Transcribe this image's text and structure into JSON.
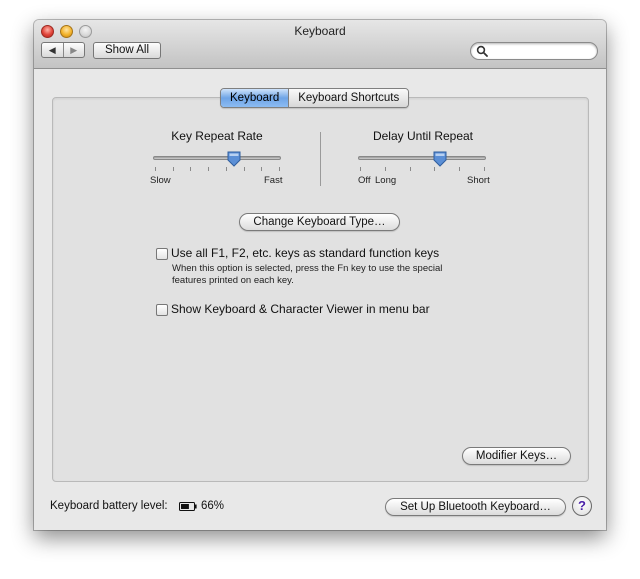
{
  "window": {
    "title": "Keyboard",
    "toolbar": {
      "back_glyph": "◀",
      "forward_glyph": "▶",
      "show_all_label": "Show All",
      "search_placeholder": ""
    }
  },
  "tabs": [
    {
      "label": "Keyboard",
      "selected": true
    },
    {
      "label": "Keyboard Shortcuts",
      "selected": false
    }
  ],
  "key_repeat_rate": {
    "label": "Key Repeat Rate",
    "min_label": "Slow",
    "max_label": "Fast",
    "tick_count": 8,
    "value_fraction": 0.63
  },
  "delay_until_repeat": {
    "label": "Delay Until Repeat",
    "min_label_a": "Off",
    "min_label_b": "Long",
    "max_label": "Short",
    "tick_count": 6,
    "value_fraction": 0.64
  },
  "change_keyboard_type_label": "Change Keyboard Type…",
  "fn_keys_option": {
    "label": "Use all F1, F2, etc. keys as standard function keys",
    "checked": false,
    "note_line1": "When this option is selected, press the Fn key to use the special",
    "note_line2": "features printed on each key."
  },
  "viewer_option": {
    "label": "Show Keyboard & Character Viewer in menu bar",
    "checked": false
  },
  "modifier_keys_label": "Modifier Keys…",
  "battery": {
    "label": "Keyboard battery level:",
    "value": "66%",
    "level": 0.66
  },
  "bluetooth_button_label": "Set Up Bluetooth Keyboard…",
  "help_glyph": "?",
  "colors": {
    "tab_selected": "#6ea4e6",
    "slider_thumb": "#5b8fd6",
    "help_glyph": "#4a1fa8"
  }
}
